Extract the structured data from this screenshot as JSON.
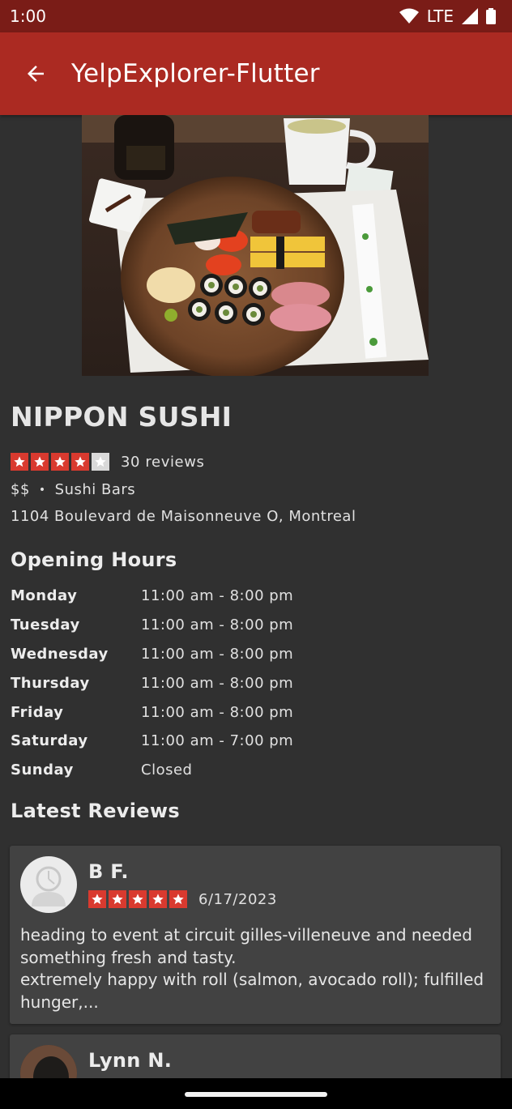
{
  "status_bar": {
    "time": "1:00",
    "network": "LTE"
  },
  "app_bar": {
    "title": "YelpExplorer-Flutter",
    "back_icon": "arrow-back-icon"
  },
  "business": {
    "name": "NIPPON SUSHI",
    "rating": 4,
    "rating_max": 5,
    "review_count": "30 reviews",
    "price": "$$",
    "separator": "•",
    "category": "Sushi Bars",
    "address": "1104 Boulevard de Maisonneuve O, Montreal"
  },
  "opening_hours": {
    "title": "Opening Hours",
    "rows": [
      {
        "day": "Monday",
        "hours": "11:00 am - 8:00 pm"
      },
      {
        "day": "Tuesday",
        "hours": "11:00 am - 8:00 pm"
      },
      {
        "day": "Wednesday",
        "hours": "11:00 am - 8:00 pm"
      },
      {
        "day": "Thursday",
        "hours": "11:00 am - 8:00 pm"
      },
      {
        "day": "Friday",
        "hours": "11:00 am - 8:00 pm"
      },
      {
        "day": "Saturday",
        "hours": "11:00 am - 7:00 pm"
      },
      {
        "day": "Sunday",
        "hours": "Closed"
      }
    ]
  },
  "reviews": {
    "title": "Latest Reviews",
    "items": [
      {
        "name": "B F.",
        "rating": 5,
        "date": "6/17/2023",
        "text": "heading to event  at circuit gilles-villeneuve and needed something fresh and tasty.\nextremely happy with roll (salmon, avocado roll); fulfilled hunger,..."
      },
      {
        "name": "Lynn N."
      }
    ]
  },
  "colors": {
    "app_bar": "#ab2a22",
    "status_bar": "#7a1c17",
    "background": "#303030",
    "card": "#424242",
    "star": "#d93a2f"
  }
}
